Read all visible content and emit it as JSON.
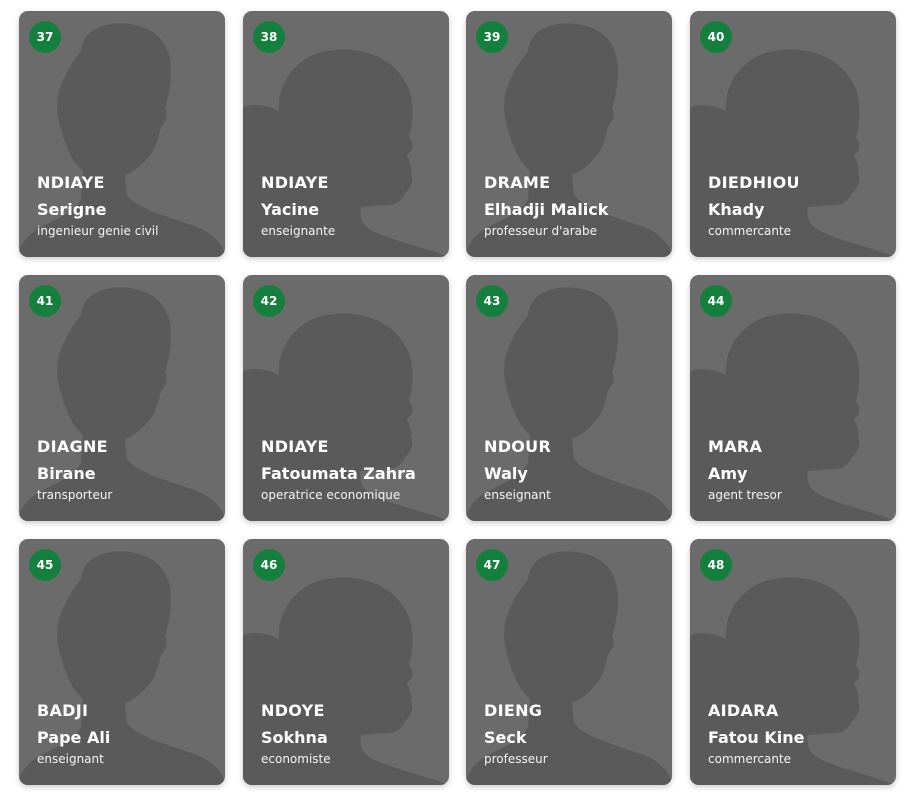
{
  "colors": {
    "card_bg": "#6b6b6b",
    "silhouette": "#5a5a5a",
    "badge_bg": "#15803d",
    "text": "#ffffff"
  },
  "cards": [
    {
      "number": "37",
      "last_name": "NDIAYE",
      "first_name": "Serigne",
      "job": "ingenieur genie civil",
      "avatar_icon": "male-silhouette-icon"
    },
    {
      "number": "38",
      "last_name": "NDIAYE",
      "first_name": "Yacine",
      "job": "enseignante",
      "avatar_icon": "female-silhouette-icon"
    },
    {
      "number": "39",
      "last_name": "DRAME",
      "first_name": "Elhadji Malick",
      "job": "professeur d'arabe",
      "avatar_icon": "male-silhouette-icon"
    },
    {
      "number": "40",
      "last_name": "DIEDHIOU",
      "first_name": "Khady",
      "job": "commercante",
      "avatar_icon": "female-silhouette-icon"
    },
    {
      "number": "41",
      "last_name": "DIAGNE",
      "first_name": "Birane",
      "job": "transporteur",
      "avatar_icon": "male-silhouette-icon"
    },
    {
      "number": "42",
      "last_name": "NDIAYE",
      "first_name": "Fatoumata Zahra",
      "job": "operatrice economique",
      "avatar_icon": "female-silhouette-icon"
    },
    {
      "number": "43",
      "last_name": "NDOUR",
      "first_name": "Waly",
      "job": "enseignant",
      "avatar_icon": "male-silhouette-icon"
    },
    {
      "number": "44",
      "last_name": "MARA",
      "first_name": "Amy",
      "job": "agent tresor",
      "avatar_icon": "female-silhouette-icon"
    },
    {
      "number": "45",
      "last_name": "BADJI",
      "first_name": "Pape Ali",
      "job": "enseignant",
      "avatar_icon": "male-silhouette-icon"
    },
    {
      "number": "46",
      "last_name": "NDOYE",
      "first_name": "Sokhna",
      "job": "economiste",
      "avatar_icon": "female-silhouette-icon"
    },
    {
      "number": "47",
      "last_name": "DIENG",
      "first_name": "Seck",
      "job": "professeur",
      "avatar_icon": "male-silhouette-icon"
    },
    {
      "number": "48",
      "last_name": "AIDARA",
      "first_name": "Fatou Kine",
      "job": "commercante",
      "avatar_icon": "female-silhouette-icon"
    }
  ]
}
